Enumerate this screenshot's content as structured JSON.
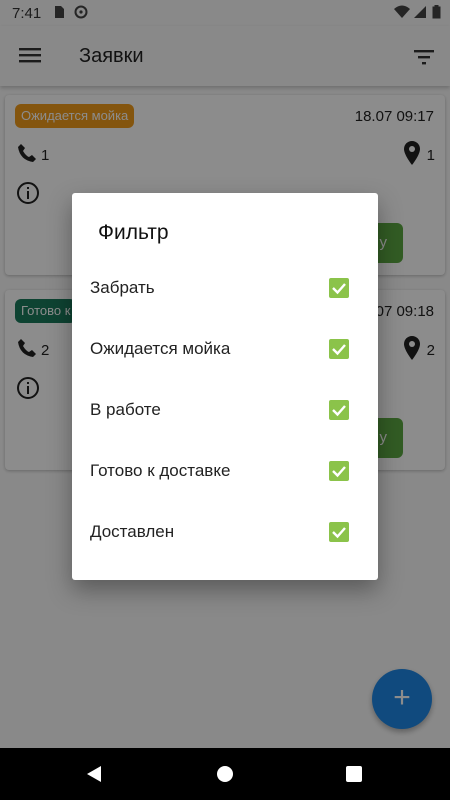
{
  "status_bar": {
    "time": "7:41"
  },
  "app_bar": {
    "title": "Заявки"
  },
  "cards": [
    {
      "status": "Ожидается мойка",
      "status_color": "#f09b1a",
      "datetime": "18.07 09:17",
      "phone_count": "1",
      "location_count": "1",
      "action_label": "у"
    },
    {
      "status": "Готово к",
      "status_color": "#1a7a5c",
      "datetime": "07 09:18",
      "phone_count": "2",
      "location_count": "2",
      "action_label": "у"
    }
  ],
  "fab": {
    "label": "+"
  },
  "dialog": {
    "title": "Фильтр",
    "options": [
      {
        "label": "Забрать",
        "checked": true
      },
      {
        "label": "Ожидается мойка",
        "checked": true
      },
      {
        "label": "В работе",
        "checked": true
      },
      {
        "label": "Готово к доставке",
        "checked": true
      },
      {
        "label": "Доставлен",
        "checked": true
      }
    ]
  },
  "colors": {
    "accent": "#1e88e5",
    "check": "#8bc34a",
    "action_button": "#5ca842"
  }
}
